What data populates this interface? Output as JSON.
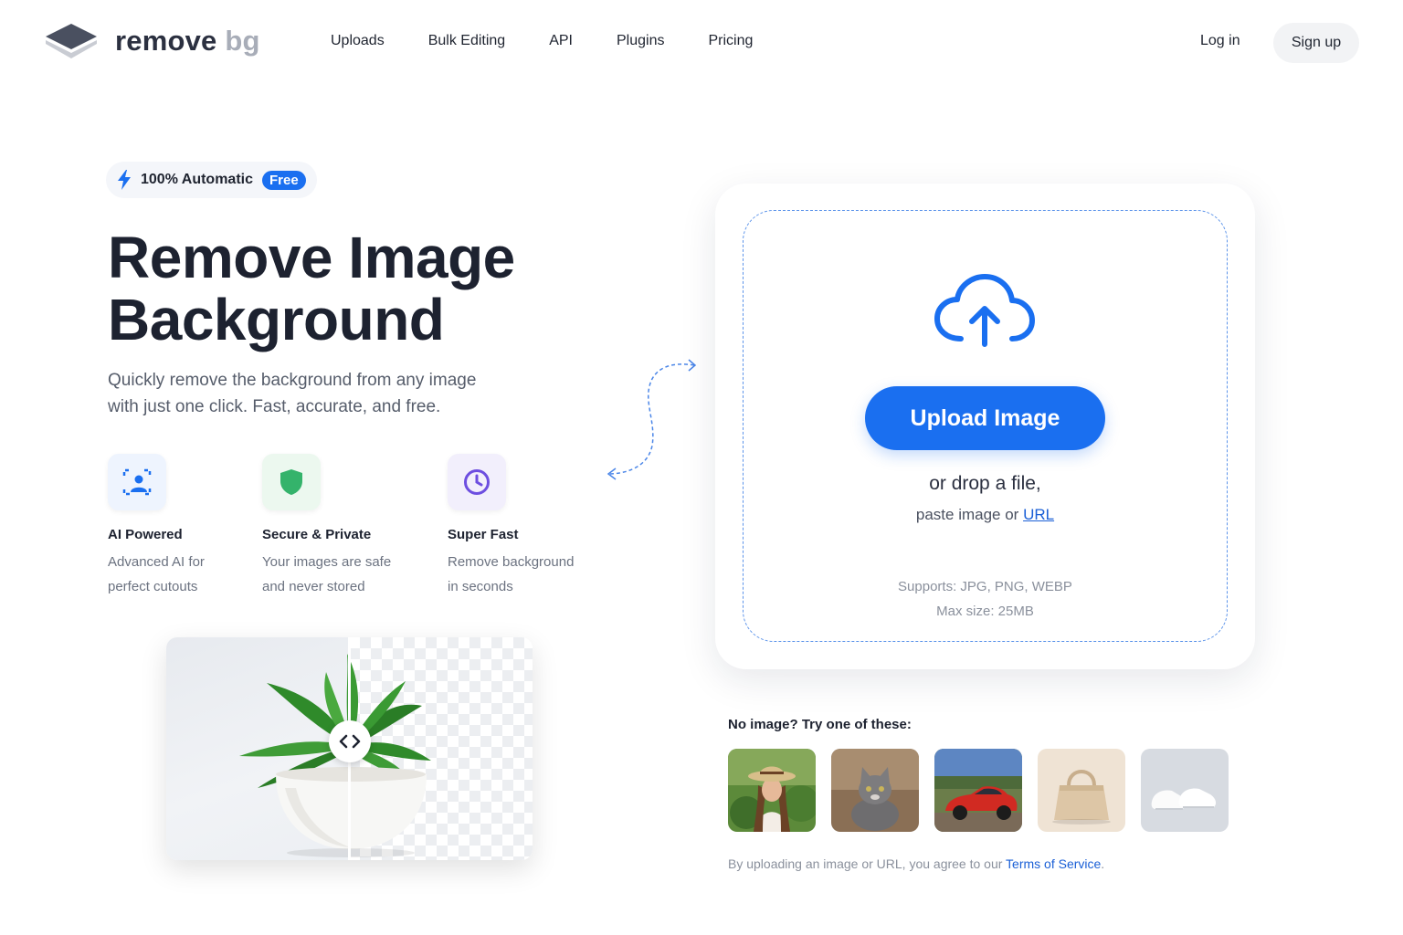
{
  "header": {
    "logo": {
      "word1": "remove",
      "word2": "bg"
    },
    "nav": [
      "Uploads",
      "Bulk Editing",
      "API",
      "Plugins",
      "Pricing"
    ],
    "login_label": "Log in",
    "signup_label": "Sign up"
  },
  "hero": {
    "badge_text": "100% Automatic",
    "badge_pill": "Free",
    "title_line1": "Remove Image",
    "title_line2": "Background",
    "subtitle_line1": "Quickly remove the background from any image",
    "subtitle_line2": "with just one click. Fast, accurate, and free.",
    "features": [
      {
        "title": "AI Powered",
        "desc1": "Advanced AI for",
        "desc2": "perfect cutouts",
        "icon": "ai-person-icon"
      },
      {
        "title": "Secure & Private",
        "desc1": "Your images are safe",
        "desc2": "and never stored",
        "icon": "shield-icon"
      },
      {
        "title": "Super Fast",
        "desc1": "Remove background",
        "desc2": " in seconds",
        "icon": "clock-icon"
      }
    ]
  },
  "upload": {
    "button_label": "Upload Image",
    "drop_text": "or drop a file,",
    "paste_text": "paste image or",
    "url_link": "URL",
    "supports": "Supports: JPG, PNG, WEBP",
    "max_size": "Max size: 25MB"
  },
  "samples": {
    "label": "No image? Try one of these:",
    "items": [
      "woman-in-hat",
      "cat",
      "red-car",
      "handbag",
      "sneakers"
    ]
  },
  "terms": {
    "text": "By uploading an image or URL, you agree to our",
    "link": "Terms of Service",
    "end": "."
  },
  "colors": {
    "accent": "#1a6ff0",
    "title": "#1d2230",
    "muted": "#6b7280"
  }
}
